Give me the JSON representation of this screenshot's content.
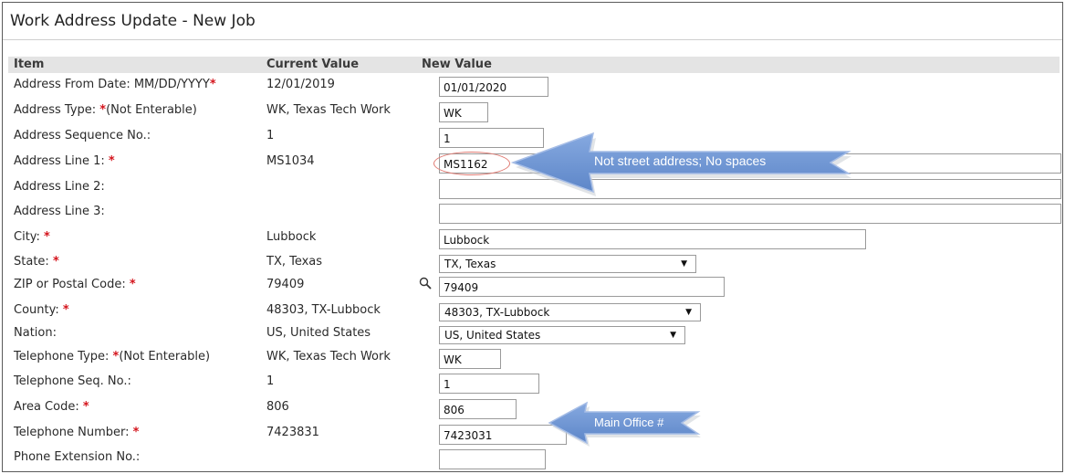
{
  "page": {
    "title": "Work Address Update - New Job"
  },
  "columns": {
    "item": "Item",
    "current": "Current Value",
    "new": "New Value"
  },
  "rows": [
    {
      "label": "Address From Date: MM/DD/YYYY",
      "required": "*",
      "suffix": "",
      "current": "12/01/2019",
      "new": "01/01/2020",
      "control": "input"
    },
    {
      "label": "Address Type: ",
      "required": "*",
      "suffix": "(Not Enterable)",
      "current": "WK, Texas Tech Work",
      "new": "WK",
      "control": "input"
    },
    {
      "label": "Address Sequence No.:",
      "required": "",
      "suffix": "",
      "current": "1",
      "new": "1",
      "control": "input"
    },
    {
      "label": "Address Line 1: ",
      "required": "*",
      "suffix": "",
      "current": "MS1034",
      "new": "MS1162",
      "control": "input"
    },
    {
      "label": "Address Line 2:",
      "required": "",
      "suffix": "",
      "current": "",
      "new": "",
      "control": "input"
    },
    {
      "label": "Address Line 3:",
      "required": "",
      "suffix": "",
      "current": "",
      "new": "",
      "control": "input"
    },
    {
      "label": "City: ",
      "required": "*",
      "suffix": "",
      "current": "Lubbock",
      "new": "Lubbock",
      "control": "input"
    },
    {
      "label": "State: ",
      "required": "*",
      "suffix": "",
      "current": "TX, Texas",
      "new": "TX, Texas",
      "control": "select"
    },
    {
      "label": "ZIP or Postal Code: ",
      "required": "*",
      "suffix": "",
      "current": "79409",
      "new": "79409",
      "control": "input"
    },
    {
      "label": "County: ",
      "required": "*",
      "suffix": "",
      "current": "48303, TX-Lubbock",
      "new": "48303, TX-Lubbock",
      "control": "select"
    },
    {
      "label": "Nation:",
      "required": "",
      "suffix": "",
      "current": "US, United States",
      "new": "US, United States",
      "control": "select"
    },
    {
      "label": "Telephone Type: ",
      "required": "*",
      "suffix": "(Not Enterable)",
      "current": "WK, Texas Tech Work",
      "new": "WK",
      "control": "input"
    },
    {
      "label": "Telephone Seq. No.:",
      "required": "",
      "suffix": "",
      "current": "1",
      "new": "1",
      "control": "input"
    },
    {
      "label": "Area Code: ",
      "required": "*",
      "suffix": "",
      "current": "806",
      "new": "806",
      "control": "input"
    },
    {
      "label": "Telephone Number: ",
      "required": "*",
      "suffix": "",
      "current": "7423831",
      "new": "7423031",
      "control": "input"
    },
    {
      "label": "Phone Extension No.:",
      "required": "",
      "suffix": "",
      "current": "",
      "new": "",
      "control": "input"
    }
  ],
  "annotations": {
    "address_callout": "Not street address; No spaces",
    "phone_callout": "Main Office #"
  },
  "icons": {
    "zip_lookup": "magnifier-icon",
    "select_caret": "caret-down-icon"
  },
  "colors": {
    "required": "#d4141c",
    "callout_fill": "#6e95d4",
    "callout_stroke": "#a6bde6",
    "circle": "#e07a72"
  }
}
